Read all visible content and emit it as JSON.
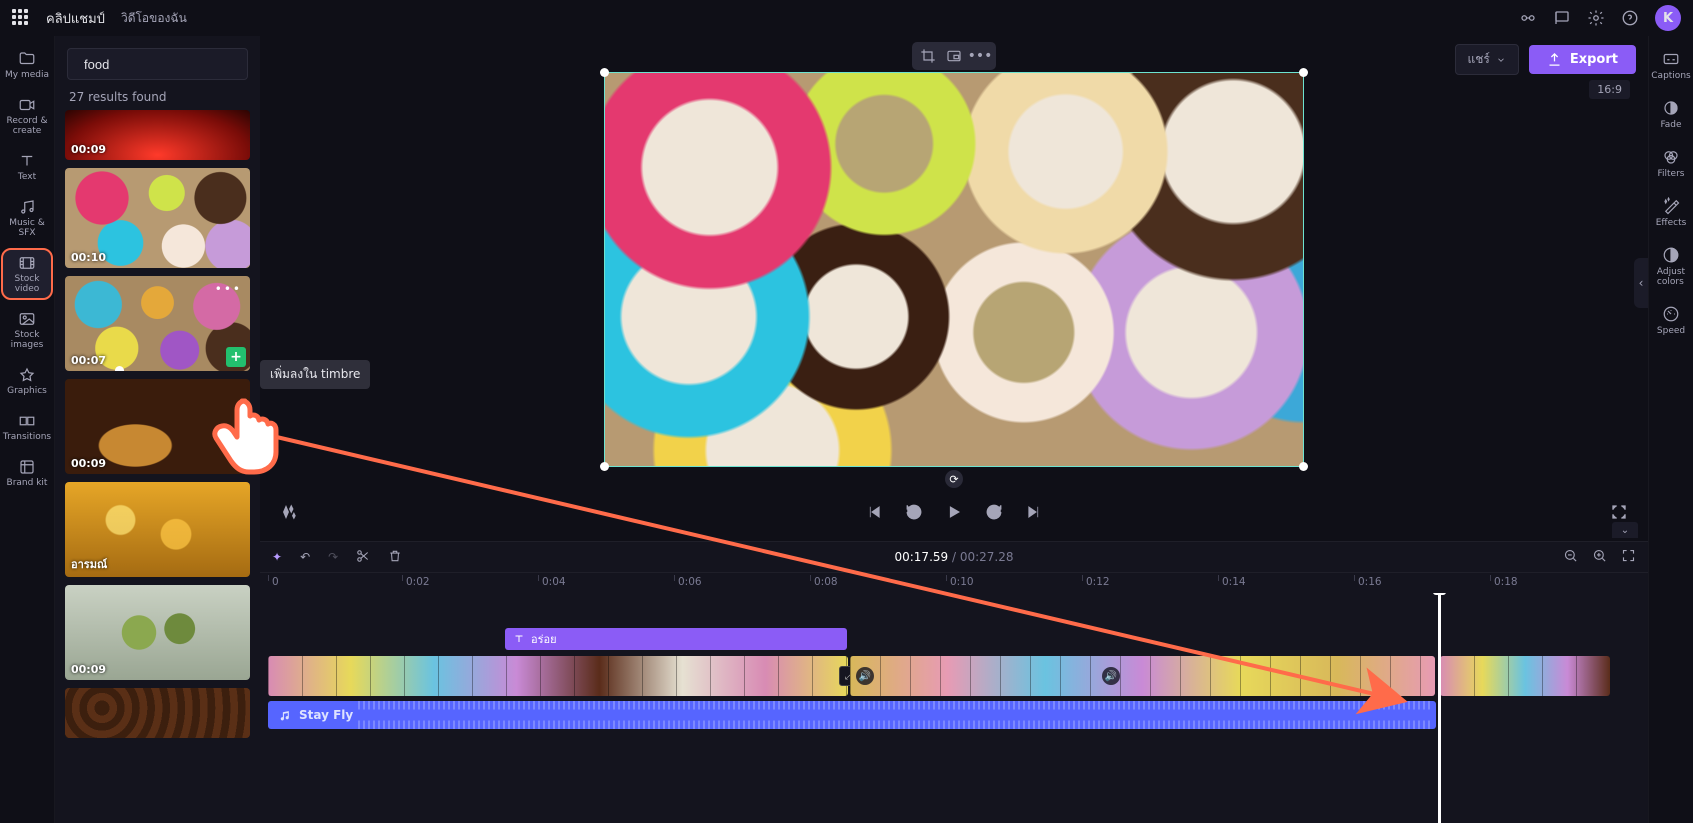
{
  "topbar": {
    "app_home": "คลิปแชมป์",
    "project_title": "วิดีโอของฉัน",
    "avatar_initial": "K"
  },
  "leftrail": [
    {
      "id": "my-media",
      "label": "My media"
    },
    {
      "id": "record-create",
      "label": "Record &\ncreate"
    },
    {
      "id": "text",
      "label": "Text"
    },
    {
      "id": "music-sfx",
      "label": "Music & SFX"
    },
    {
      "id": "stock-video",
      "label": "Stock video"
    },
    {
      "id": "stock-images",
      "label": "Stock\nimages"
    },
    {
      "id": "graphics",
      "label": "Graphics"
    },
    {
      "id": "transitions",
      "label": "Transitions"
    },
    {
      "id": "brand-kit",
      "label": "Brand kit"
    }
  ],
  "search": {
    "placeholder": "",
    "value": "food"
  },
  "results_text": "27 results found",
  "clips": [
    {
      "duration": "00:09",
      "thumb": "t-red"
    },
    {
      "duration": "00:10",
      "thumb": "t-don"
    },
    {
      "duration": "00:07",
      "thumb": "t-don2"
    },
    {
      "duration": "00:09",
      "thumb": "t-pot"
    },
    {
      "duration": "อารมณ์",
      "thumb": "t-honey"
    },
    {
      "duration": "00:09",
      "thumb": "t-olive"
    },
    {
      "duration": "",
      "thumb": "t-beans"
    }
  ],
  "tooltip": "เพิ่มลงใน timbre",
  "preview_toolbar": {
    "share": "แชร์",
    "export": "Export",
    "ratio": "16:9"
  },
  "timeline": {
    "current": "00:17.59",
    "total": "00:27.28",
    "ticks": [
      "0",
      "0:02",
      "0:04",
      "0:06",
      "0:08",
      "0:10",
      "0:12",
      "0:14",
      "0:16",
      "0:18"
    ],
    "text_clip_label": "อร่อย",
    "audio_clip_label": "Stay Fly"
  },
  "rightrail": [
    {
      "id": "captions",
      "label": "Captions"
    },
    {
      "id": "fade",
      "label": "Fade"
    },
    {
      "id": "filters",
      "label": "Filters"
    },
    {
      "id": "effects",
      "label": "Effects"
    },
    {
      "id": "adjust-colors",
      "label": "Adjust\ncolors"
    },
    {
      "id": "speed",
      "label": "Speed"
    }
  ]
}
